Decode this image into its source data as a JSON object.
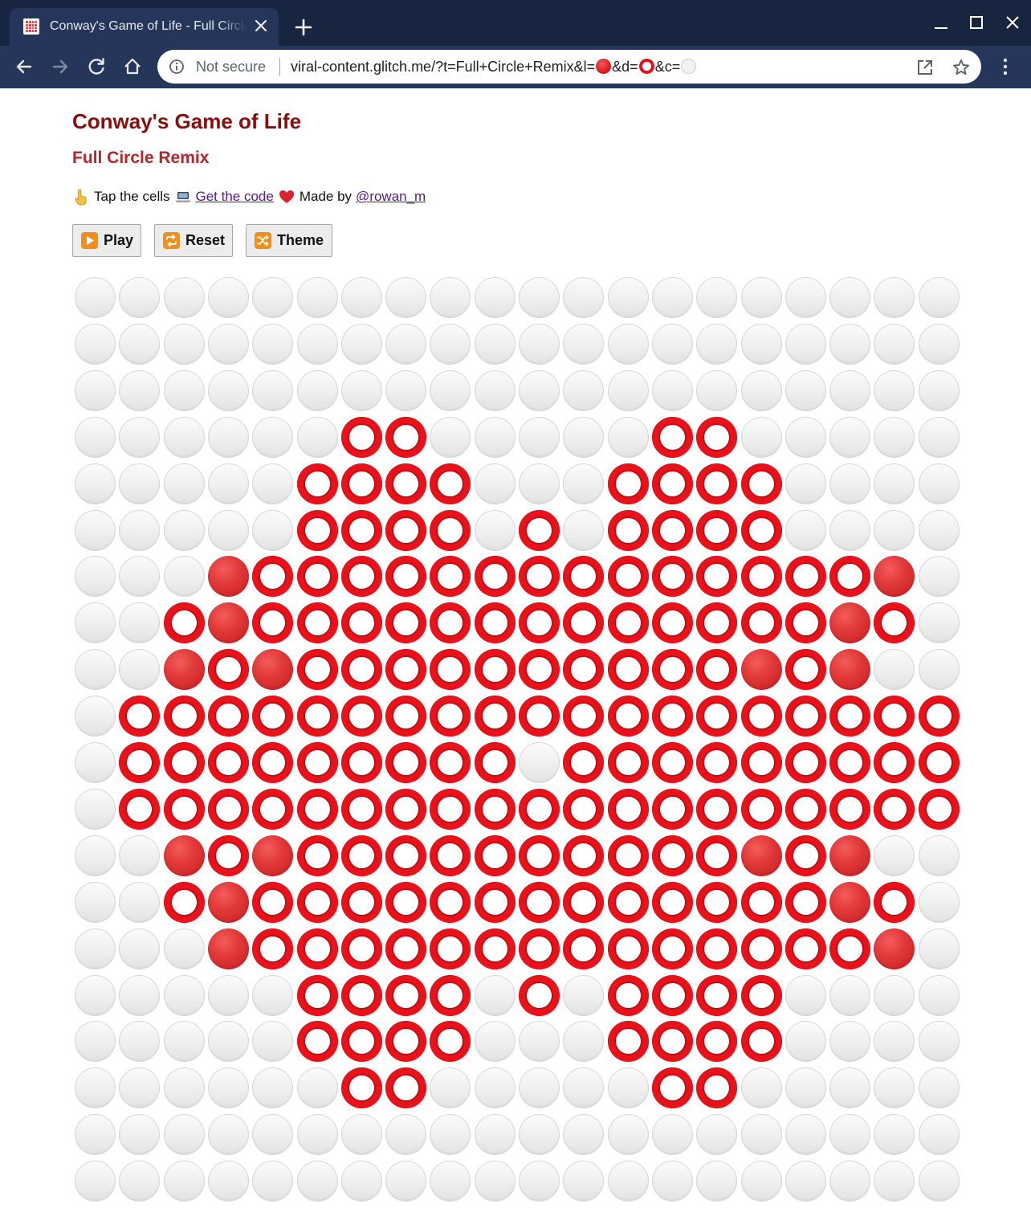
{
  "browser": {
    "tab_title": "Conway's Game of Life - Full Circle Remix",
    "security_label": "Not secure",
    "url_prefix": "viral-content.glitch.me/?t=Full+Circle+Remix&l=",
    "url_d": "&d=",
    "url_c": "&c="
  },
  "page": {
    "title": "Conway's Game of Life",
    "subtitle": "Full Circle Remix",
    "tap_text": "Tap the cells",
    "code_link": "Get the code",
    "made_by": "Made by",
    "author_link": "@rowan_m"
  },
  "buttons": {
    "play": "Play",
    "reset": "Reset",
    "theme": "Theme"
  },
  "colors": {
    "title": "#8b0c0c",
    "subtitle": "#b3262a",
    "live_cell": "#e8121b",
    "dying_cell": "#d4141a",
    "empty_cell": "#efefef",
    "chrome_dark": "#172540",
    "chrome_toolbar": "#25365a"
  },
  "icons": {
    "favicon": "game-of-life-favicon",
    "play": "play-button-emoji",
    "reset": "repeat-arrows-emoji",
    "theme": "shuffle-arrows-emoji"
  },
  "grid": {
    "legend": {
      ".": "empty",
      "o": "ring",
      "x": "filled"
    },
    "rows": [
      "....................",
      "....................",
      "....................",
      "......oo.....oo.....",
      ".....oooo...oooo....",
      ".....oooo.o.oooo....",
      "...xoooooooooooooox..",
      "..oxoooooooooooooxo.",
      "..xoxooooooooooxox..",
      ".ooooooooooooooooooo",
      ".ooooooooo.ooooooooo",
      ".ooooooooooooooooooo",
      "..xoxooooooooooxox..",
      "..oxoooooooooooooxo.",
      "...xoooooooooooooox..",
      ".....oooo.o.oooo....",
      ".....oooo...oooo....",
      "......oo.....oo.....",
      "....................",
      "...................."
    ]
  }
}
